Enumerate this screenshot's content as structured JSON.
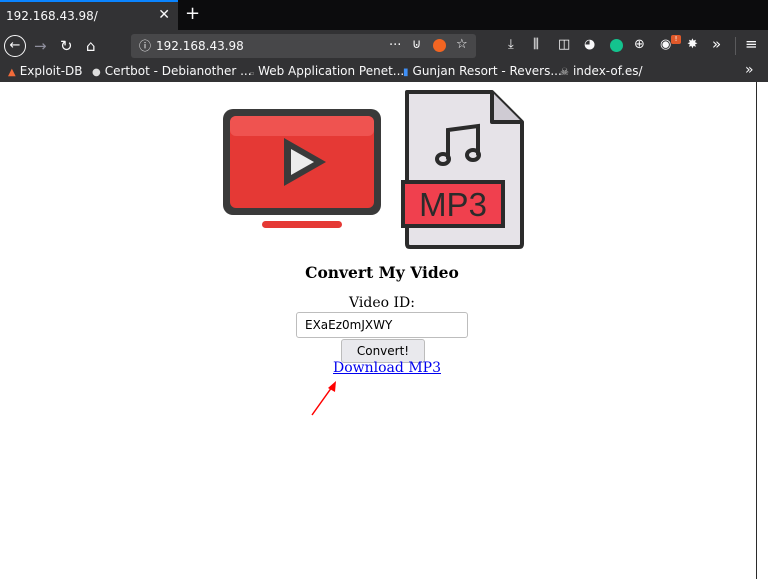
{
  "browser": {
    "tab_title": "192.168.43.98/",
    "tab_close": "✕",
    "new_tab": "+",
    "url": "192.168.43.98",
    "url_more": "···",
    "overflow": "»",
    "menu": "≡"
  },
  "bookmarks": [
    {
      "label": "Exploit-DB",
      "icon": "flame-icon"
    },
    {
      "label": "Certbot - Debianother ...",
      "icon": "certbot-icon"
    },
    {
      "label": "Web Application Penet...",
      "icon": "page-icon"
    },
    {
      "label": "Gunjan Resort - Revers...",
      "icon": "chart-icon"
    },
    {
      "label": "index-of.es/",
      "icon": "skull-icon"
    }
  ],
  "page": {
    "mp3_label": "MP3",
    "heading": "Convert My Video",
    "input_label": "Video ID:",
    "video_id": "EXaEz0mJXWY",
    "convert_label": "Convert!",
    "download_label": "Download MP3"
  },
  "colors": {
    "youtube_red": "#e53935",
    "mp3_red": "#f0404e",
    "link": "#0000ee",
    "annotation_arrow": "#ff0000"
  }
}
